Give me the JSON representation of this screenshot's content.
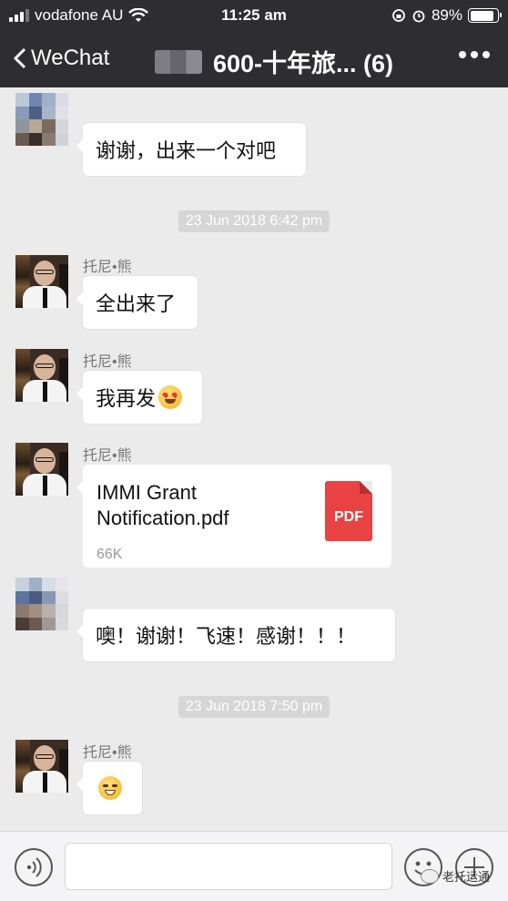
{
  "status_bar": {
    "carrier": "vodafone AU",
    "time": "11:25 am",
    "battery": "89%",
    "battery_level": 0.89
  },
  "nav": {
    "back_label": "WeChat",
    "title": "600-十年旅... (6)"
  },
  "messages": [
    {
      "text": "谢谢，出来一个对吧"
    },
    {
      "timestamp": "23 Jun 2018 6:42 pm"
    },
    {
      "sender": "托尼•熊",
      "text": "全出来了"
    },
    {
      "sender": "托尼•熊",
      "text": "我再发"
    },
    {
      "sender": "托尼•熊",
      "file": {
        "name": "IMMI Grant Notification.pdf",
        "size": "66K",
        "type": "PDF"
      }
    },
    {
      "text": "噢！谢谢！飞速！感谢！！！"
    },
    {
      "timestamp": "23 Jun 2018 7:50 pm"
    },
    {
      "sender": "托尼•熊"
    }
  ],
  "watermark": "老托运通",
  "icons": {
    "back": "chevron-left-icon",
    "more": "more-icon",
    "voice": "voice-icon",
    "emoji": "smile-icon",
    "plus": "plus-icon",
    "file": "pdf-icon"
  },
  "colors": {
    "nav_bg": "#2e2e32",
    "chat_bg": "#ebebeb",
    "pdf_red": "#e84342"
  }
}
